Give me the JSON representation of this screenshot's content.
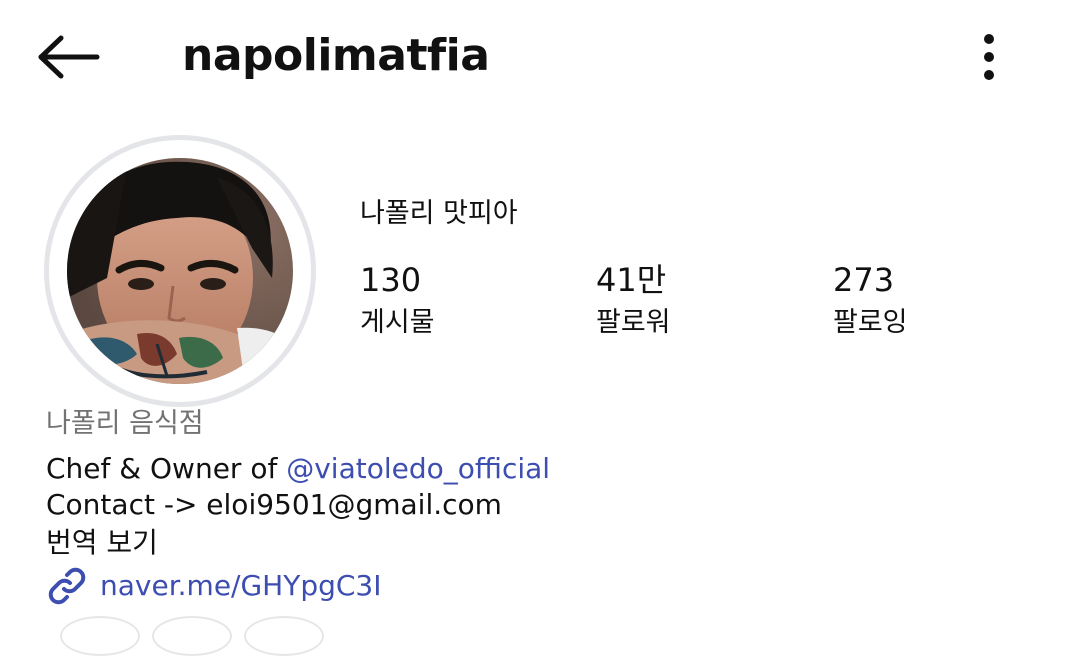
{
  "header": {
    "username": "napolimatfia",
    "back_icon": "arrow-left-icon",
    "more_icon": "more-vertical-icon"
  },
  "profile": {
    "display_name": "나폴리 맛피아",
    "stats": [
      {
        "value": "130",
        "label": "게시물"
      },
      {
        "value": "41만",
        "label": "팔로워"
      },
      {
        "value": "273",
        "label": "팔로잉"
      }
    ],
    "category": "나폴리 음식점",
    "bio": {
      "line1_prefix": "Chef & Owner of ",
      "line1_mention": "@viatoledo_official",
      "line2": "Contact -> eloi9501@gmail.com",
      "translate": "번역 보기"
    },
    "link": {
      "icon": "link-icon",
      "text": "naver.me/GHYpgC3I"
    }
  },
  "colors": {
    "link_blue": "#3d4eb0",
    "secondary_text": "#737373",
    "ring_gray": "#e3e5e8"
  }
}
